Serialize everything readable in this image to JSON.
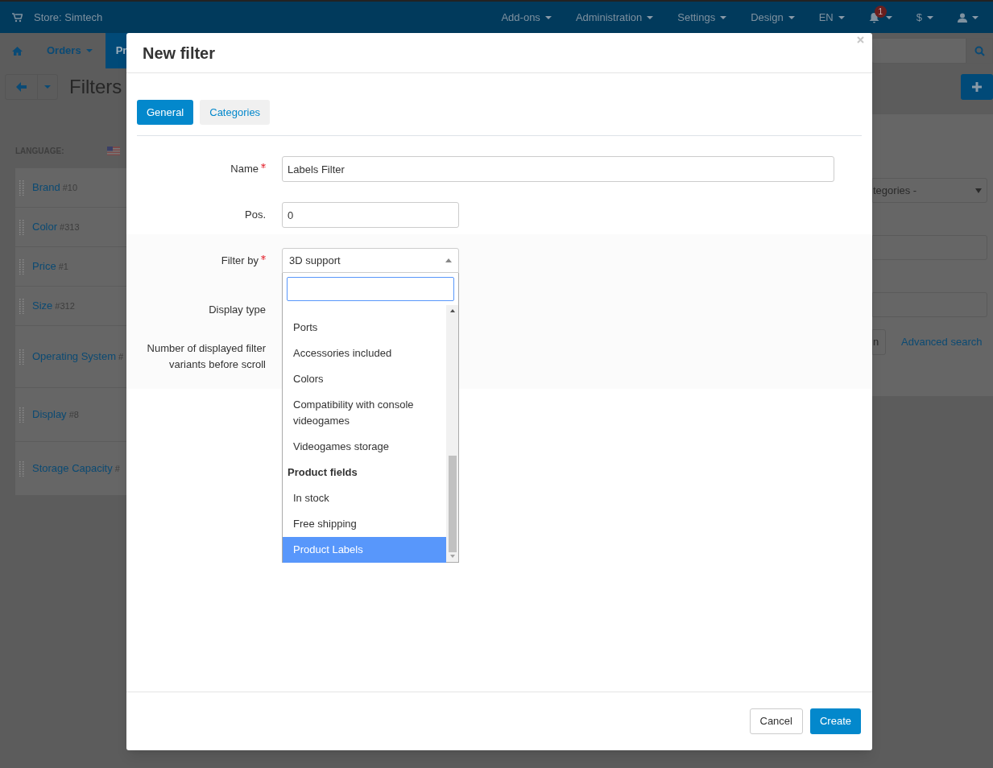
{
  "top_bar": {
    "store": "Store: Simtech",
    "menus": [
      "Add-ons",
      "Administration",
      "Settings",
      "Design",
      "EN"
    ],
    "notifications": "1",
    "currency": "$"
  },
  "nav": {
    "items": [
      {
        "label": "Orders",
        "selected": false
      },
      {
        "label": "Pr",
        "selected": true
      }
    ]
  },
  "page": {
    "title": "Filters"
  },
  "sidebar": {
    "language_label": "LANGUAGE:",
    "items": [
      {
        "name": "Brand",
        "id": "#10"
      },
      {
        "name": "Color",
        "id": "#313"
      },
      {
        "name": "Price",
        "id": "#1"
      },
      {
        "name": "Size",
        "id": "#312"
      },
      {
        "name": "Operating System",
        "id": "#"
      },
      {
        "name": "Display",
        "id": "#8"
      },
      {
        "name": "Storage Capacity",
        "id": "#"
      }
    ]
  },
  "search_panel": {
    "select_value": "tegories -",
    "button": "n",
    "link": "Advanced search"
  },
  "modal": {
    "title": "New filter",
    "tabs": [
      {
        "label": "General",
        "selected": true
      },
      {
        "label": "Categories",
        "selected": false
      }
    ],
    "fields": [
      {
        "label": "Name",
        "required": true,
        "kind": "input",
        "value": "Labels Filter",
        "wide": true
      },
      {
        "label": "Pos.",
        "required": false,
        "kind": "input",
        "value": "0",
        "wide": false
      },
      {
        "label": "Filter by",
        "required": true,
        "kind": "select",
        "value": "3D support",
        "wide": false
      },
      {
        "label": "Display type",
        "required": false,
        "kind": "covered"
      },
      {
        "label": "Number of displayed filter variants before scroll",
        "required": false,
        "kind": "covered"
      }
    ],
    "dropdown": {
      "options": [
        {
          "kind": "option",
          "label": "Ports",
          "selected": false
        },
        {
          "kind": "option",
          "label": "Accessories included",
          "selected": false
        },
        {
          "kind": "option",
          "label": "Colors",
          "selected": false
        },
        {
          "kind": "option",
          "label": "Compatibility with console videogames",
          "selected": false
        },
        {
          "kind": "option",
          "label": "Videogames storage",
          "selected": false
        },
        {
          "kind": "group",
          "label": "Product fields"
        },
        {
          "kind": "option",
          "label": "In stock",
          "selected": false
        },
        {
          "kind": "option",
          "label": "Free shipping",
          "selected": false
        },
        {
          "kind": "option",
          "label": "Product Labels",
          "selected": true
        }
      ]
    },
    "buttons": [
      {
        "label": "Cancel",
        "kind": "secondary"
      },
      {
        "label": "Create",
        "kind": "primary"
      }
    ]
  }
}
